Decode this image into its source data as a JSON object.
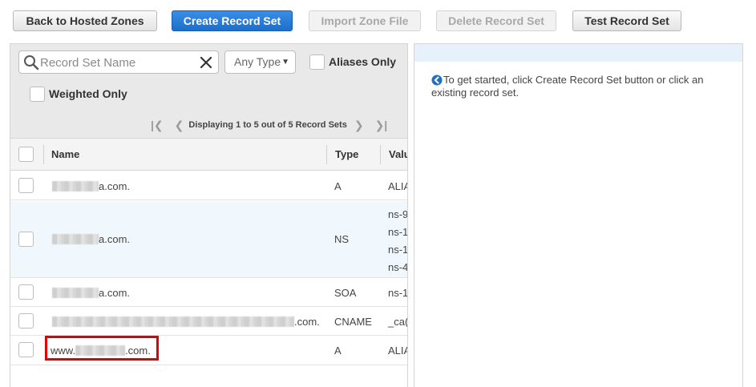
{
  "toolbar": {
    "back": "Back to Hosted Zones",
    "create": "Create Record Set",
    "import": "Import Zone File",
    "delete": "Delete Record Set",
    "test": "Test Record Set"
  },
  "filters": {
    "search_placeholder": "Record Set Name",
    "type_selected": "Any Type",
    "aliases_only": "Aliases Only",
    "weighted_only": "Weighted Only"
  },
  "pagination": {
    "status": "Displaying 1 to 5 out of 5 Record Sets"
  },
  "table": {
    "columns": [
      "Name",
      "Type",
      "Valu"
    ],
    "rows": [
      {
        "name": "a.com.",
        "type": "A",
        "value": [
          "ALIA"
        ]
      },
      {
        "name": "a.com.",
        "type": "NS",
        "value": [
          "ns-9",
          "ns-1",
          "ns-1",
          "ns-4"
        ]
      },
      {
        "name": "a.com.",
        "type": "SOA",
        "value": [
          "ns-1"
        ]
      },
      {
        "name": ".com.",
        "type": "CNAME",
        "value": [
          "_ca("
        ]
      },
      {
        "name_prefix": "www.",
        "name": ".com.",
        "type": "A",
        "value": [
          "ALIA"
        ]
      }
    ]
  },
  "info": {
    "message": "To get started, click Create Record Set button or click an existing record set."
  },
  "colors": {
    "primary": "#1d6fc9",
    "highlight": "#e30000",
    "info_icon": "#1f6fc6",
    "selected_row": "#f1f8fd"
  }
}
